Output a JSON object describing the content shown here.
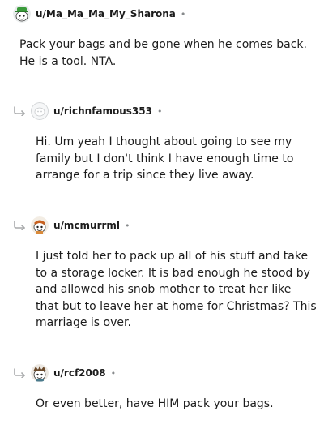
{
  "comments": [
    {
      "username": "u/Ma_Ma_Ma_My_Sharona",
      "separator": "•",
      "avatar_icon": "snoo-avatar-green-hat-icon",
      "is_reply": false,
      "text": "Pack your bags and be gone when he comes back.\nHe is a tool. NTA."
    },
    {
      "username": "u/richnfamous353",
      "separator": "•",
      "avatar_icon": "default-avatar-gray-icon",
      "is_reply": true,
      "text": "Hi. Um yeah I thought about going to see my\nfamily but I don't think I have enough time to\narrange for a trip since they live away."
    },
    {
      "username": "u/mcmurrml",
      "separator": "•",
      "avatar_icon": "snoo-avatar-orange-icon",
      "is_reply": true,
      "text": "I just told her to pack up all of his stuff and take\nto a storage locker. It is bad enough he stood by\nand allowed his snob mother to treat her like\nthat but to leave her at home for Christmas? This\nmarriage is over."
    },
    {
      "username": "u/rcf2008",
      "separator": "•",
      "avatar_icon": "snoo-avatar-brown-icon",
      "is_reply": true,
      "text": "Or even better, have HIM pack your bags."
    }
  ],
  "colors": {
    "text": "#1c1c1c",
    "meta": "#878a8c",
    "reply_arrow": "#a8aaab"
  }
}
